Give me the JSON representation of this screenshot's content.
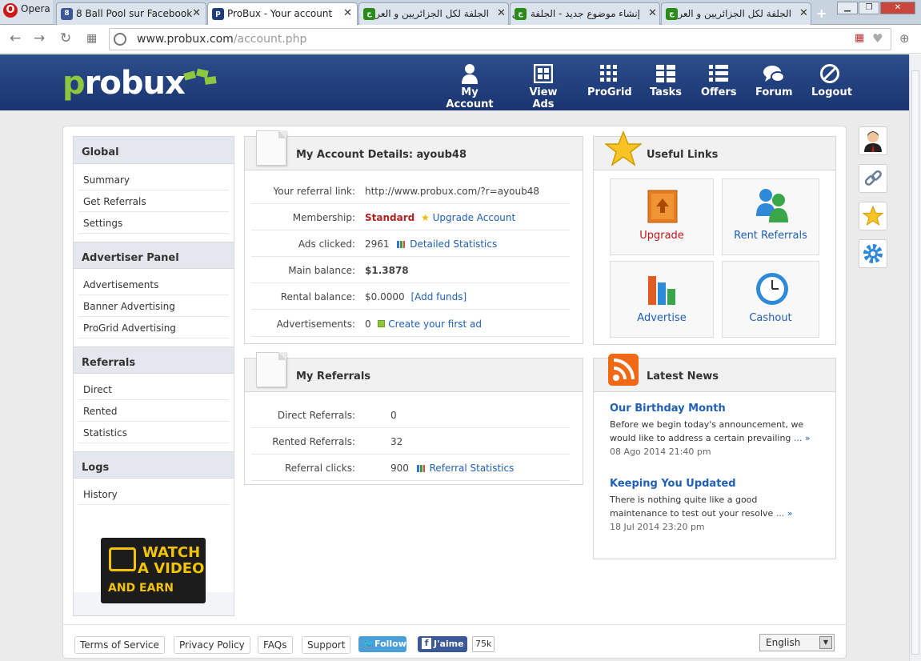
{
  "browser": {
    "opera_label": "Opera",
    "tabs": [
      {
        "title": "8 Ball Pool sur Facebook"
      },
      {
        "title": "ProBux - Your account"
      },
      {
        "title": "الجلفة لكل الجزائريين و العرب"
      },
      {
        "title": "إنشاء موضوع جديد - الجلفة لكل الجزائريين و العرب"
      },
      {
        "title": "الجلفة لكل الجزائريين و العرب"
      }
    ],
    "url_domain": "www.probux.com",
    "url_path": "/account.php"
  },
  "header": {
    "logo_text_p": "p",
    "logo_text_rest": "robux",
    "nav": [
      {
        "label": "My Account"
      },
      {
        "label": "View Ads"
      },
      {
        "label": "ProGrid"
      },
      {
        "label": "Tasks"
      },
      {
        "label": "Offers"
      },
      {
        "label": "Forum"
      },
      {
        "label": "Logout"
      }
    ]
  },
  "sidebar": {
    "sections": [
      {
        "title": "Global",
        "items": [
          "Summary",
          "Get Referrals",
          "Settings"
        ]
      },
      {
        "title": "Advertiser Panel",
        "items": [
          "Advertisements",
          "Banner Advertising",
          "ProGrid Advertising"
        ]
      },
      {
        "title": "Referrals",
        "items": [
          "Direct",
          "Rented",
          "Statistics"
        ]
      },
      {
        "title": "Logs",
        "items": [
          "History"
        ]
      }
    ],
    "banner": {
      "line1": "WATCH",
      "line2": "A VIDEO",
      "line3": "AND EARN"
    }
  },
  "account": {
    "title": "My Account Details: ayoub48",
    "referral_link_label": "Your referral link:",
    "referral_link": "http://www.probux.com/?r=ayoub48",
    "membership_label": "Membership:",
    "membership": "Standard",
    "upgrade_link": "Upgrade Account",
    "ads_clicked_label": "Ads clicked:",
    "ads_clicked": "2961",
    "detailed_stats": "Detailed Statistics",
    "main_balance_label": "Main balance:",
    "main_balance": "$1.3878",
    "rental_balance_label": "Rental balance:",
    "rental_balance": "$0.0000",
    "add_funds": "[Add funds]",
    "advertisements_label": "Advertisements:",
    "advertisements": "0",
    "create_ad": "Create your first ad"
  },
  "referrals": {
    "title": "My Referrals",
    "direct_label": "Direct Referrals:",
    "direct": "0",
    "rented_label": "Rented Referrals:",
    "rented": "32",
    "clicks_label": "Referral clicks:",
    "clicks": "900",
    "stats_link": "Referral Statistics"
  },
  "useful_links": {
    "title": "Useful Links",
    "tiles": [
      {
        "label": "Upgrade",
        "color": "#c0141b"
      },
      {
        "label": "Rent Referrals",
        "color": "#1f5fb5"
      },
      {
        "label": "Advertise",
        "color": "#1f5fb5"
      },
      {
        "label": "Cashout",
        "color": "#1f5fb5"
      }
    ]
  },
  "news": {
    "title": "Latest News",
    "items": [
      {
        "title": "Our Birthday Month",
        "body1": "Before we begin today's announcement, we",
        "body2": "would like to address a certain prevailing ",
        "more": "... »",
        "date": "08 Ago 2014 21:40 pm"
      },
      {
        "title": "Keeping You Updated",
        "body1": "There is nothing quite like a good",
        "body2": "maintenance to test out your resolve ",
        "more": "... »",
        "date": "18 Jul 2014 23:20 pm"
      }
    ]
  },
  "footer": {
    "links": [
      "Terms of Service",
      "Privacy Policy",
      "FAQs",
      "Support"
    ],
    "twitter": "Follow",
    "facebook": "J'aime",
    "fb_count": "75k",
    "language": "English"
  },
  "colors": {
    "header_bg": "#1f3d7c",
    "logo_green": "#8dc63f",
    "link": "#1f5fb5"
  }
}
